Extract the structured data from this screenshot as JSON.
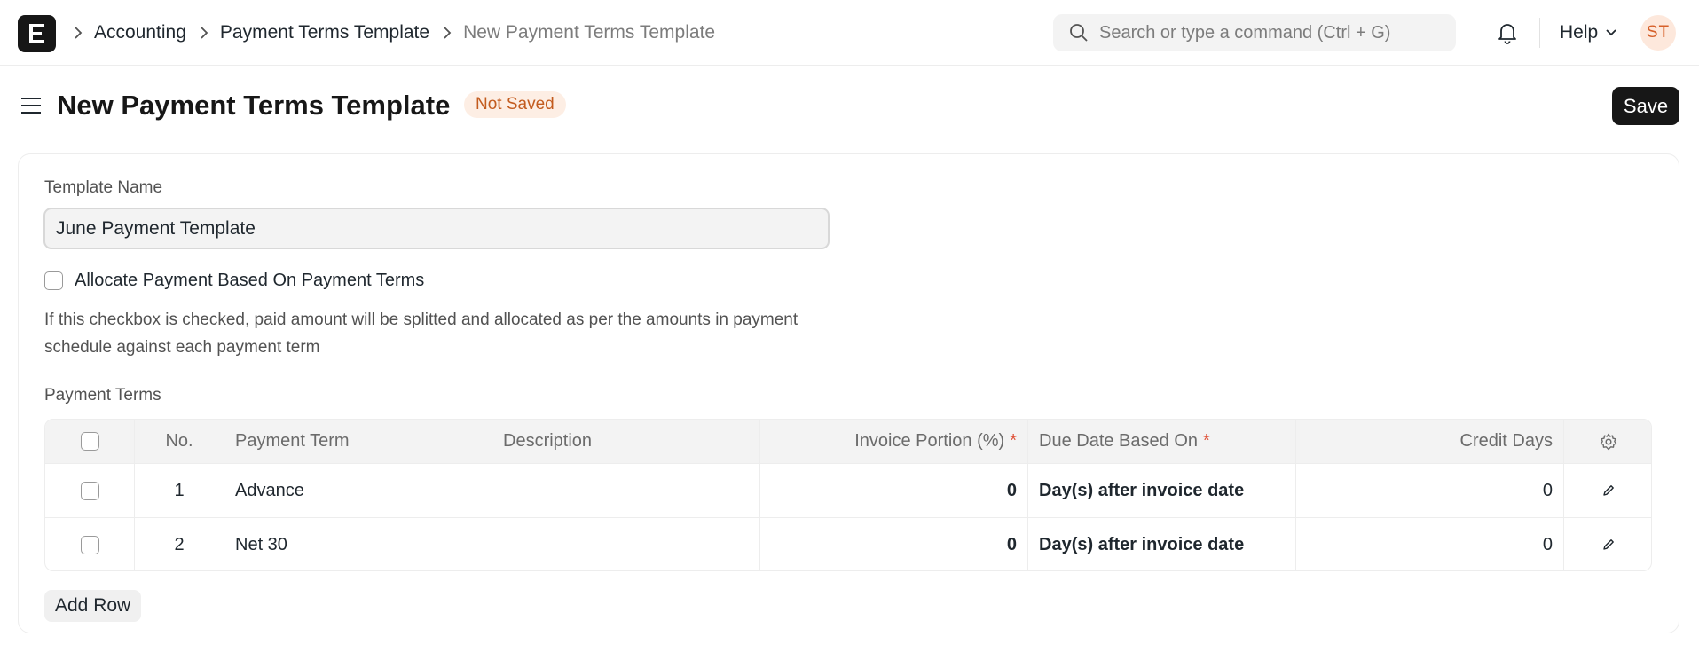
{
  "navbar": {
    "logo_letter": "E",
    "breadcrumbs": [
      "Accounting",
      "Payment Terms Template",
      "New Payment Terms Template"
    ],
    "search_placeholder": "Search or type a command (Ctrl + G)",
    "help_label": "Help",
    "avatar_initials": "ST"
  },
  "page": {
    "title": "New Payment Terms Template",
    "status": "Not Saved",
    "save_label": "Save"
  },
  "form": {
    "template_name_label": "Template Name",
    "template_name_value": "June Payment Template",
    "allocate_label": "Allocate Payment Based On Payment Terms",
    "allocate_checked": false,
    "allocate_help": "If this checkbox is checked, paid amount will be splitted and allocated as per the amounts in payment schedule against each payment term",
    "payment_terms_label": "Payment Terms",
    "add_row_label": "Add Row"
  },
  "table": {
    "columns": {
      "no": "No.",
      "payment_term": "Payment Term",
      "description": "Description",
      "invoice_portion": "Invoice Portion (%)",
      "due_date_based_on": "Due Date Based On",
      "credit_days": "Credit Days"
    },
    "required_mark": "*",
    "rows": [
      {
        "no": "1",
        "payment_term": "Advance",
        "description": "",
        "invoice_portion": "0",
        "due_date_based_on": "Day(s) after invoice date",
        "credit_days": "0"
      },
      {
        "no": "2",
        "payment_term": "Net 30",
        "description": "",
        "invoice_portion": "0",
        "due_date_based_on": "Day(s) after invoice date",
        "credit_days": "0"
      }
    ]
  },
  "colors": {
    "primary": "#171717",
    "status_bg": "#fdeee4",
    "status_text": "#c35b1e",
    "required": "#e0533a",
    "avatar_bg": "#fde8dc",
    "avatar_text": "#d6602a"
  }
}
